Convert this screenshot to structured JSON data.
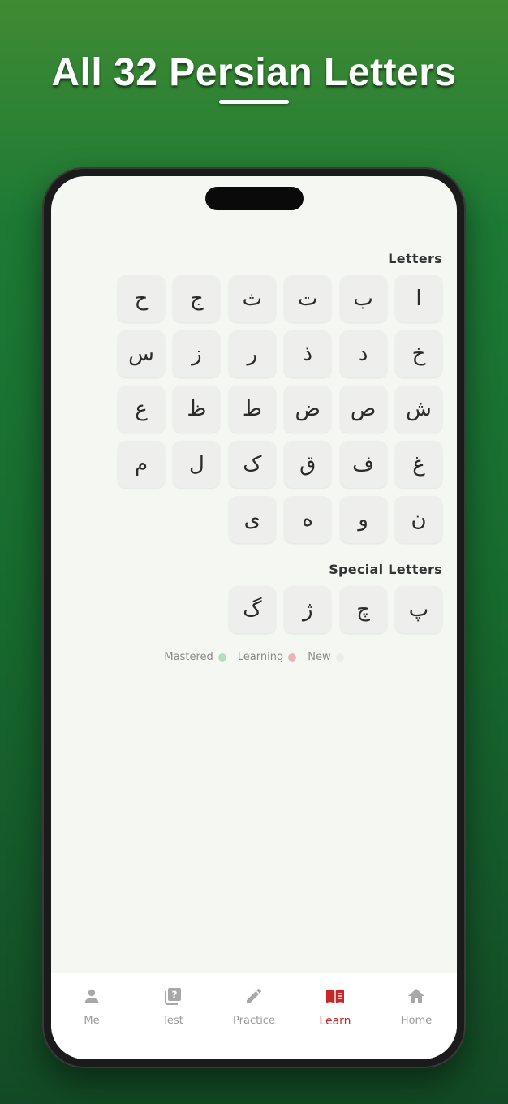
{
  "headline": "All 32 Persian Letters",
  "sections": {
    "letters_title": "Letters",
    "special_title": "Special Letters"
  },
  "letters": [
    "ا",
    "ب",
    "ت",
    "ث",
    "ج",
    "ح",
    "خ",
    "د",
    "ذ",
    "ر",
    "ز",
    "س",
    "ش",
    "ص",
    "ض",
    "ط",
    "ظ",
    "ع",
    "غ",
    "ف",
    "ق",
    "ک",
    "ل",
    "م",
    "ن",
    "و",
    "ه",
    "ی"
  ],
  "special_letters": [
    "پ",
    "چ",
    "ژ",
    "گ"
  ],
  "legend": {
    "mastered": "Mastered",
    "learning": "Learning",
    "new": "New",
    "colors": {
      "mastered": "#b9dcc0",
      "learning": "#eab4b4",
      "new": "#ececec"
    }
  },
  "tabs": [
    {
      "id": "me",
      "label": "Me",
      "icon": "person-icon",
      "active": false
    },
    {
      "id": "test",
      "label": "Test",
      "icon": "quiz-icon",
      "active": false
    },
    {
      "id": "practice",
      "label": "Practice",
      "icon": "pencil-icon",
      "active": false
    },
    {
      "id": "learn",
      "label": "Learn",
      "icon": "book-icon",
      "active": true
    },
    {
      "id": "home",
      "label": "Home",
      "icon": "home-icon",
      "active": false
    }
  ],
  "accent_color": "#c62828"
}
